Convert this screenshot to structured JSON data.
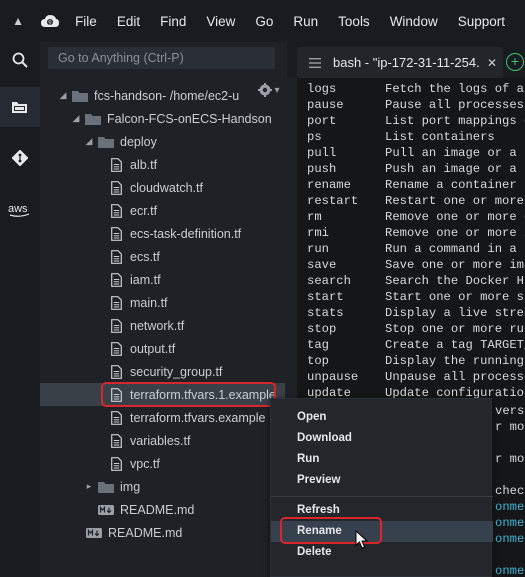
{
  "menubar": {
    "items": [
      "File",
      "Edit",
      "Find",
      "View",
      "Go",
      "Run",
      "Tools",
      "Window",
      "Support"
    ]
  },
  "search": {
    "placeholder": "Go to Anything (Ctrl-P)"
  },
  "tree": {
    "root_name": "fcs-handson",
    "root_path": " - /home/ec2-u",
    "project": "Falcon-FCS-onECS-Handson",
    "deploy_folder": "deploy",
    "deploy_files": [
      "alb.tf",
      "cloudwatch.tf",
      "ecr.tf",
      "ecs-task-definition.tf",
      "ecs.tf",
      "iam.tf",
      "main.tf",
      "network.tf",
      "output.tf",
      "security_group.tf",
      "terraform.tfvars.1.example",
      "terraform.tfvars.example",
      "variables.tf",
      "vpc.tf"
    ],
    "img_folder": "img",
    "readme_inner": "README.md",
    "readme_root": "README.md"
  },
  "terminal": {
    "tab_title": "bash - \"ip-172-31-11-254.",
    "lines": [
      {
        "cmd": "logs",
        "desc": "Fetch the logs of a co"
      },
      {
        "cmd": "pause",
        "desc": "Pause all processes wi"
      },
      {
        "cmd": "port",
        "desc": "List port mappings or"
      },
      {
        "cmd": "ps",
        "desc": "List containers"
      },
      {
        "cmd": "pull",
        "desc": "Pull an image or a rep"
      },
      {
        "cmd": "push",
        "desc": "Push an image or a rep"
      },
      {
        "cmd": "rename",
        "desc": "Rename a container"
      },
      {
        "cmd": "restart",
        "desc": "Restart one or more co"
      },
      {
        "cmd": "rm",
        "desc": "Remove one or more cont"
      },
      {
        "cmd": "rmi",
        "desc": "Remove one or more imag"
      },
      {
        "cmd": "run",
        "desc": "Run a command in a new"
      },
      {
        "cmd": "save",
        "desc": "Save one or more images"
      },
      {
        "cmd": "search",
        "desc": "Search the Docker Hub f"
      },
      {
        "cmd": "start",
        "desc": "Start one or more stopp"
      },
      {
        "cmd": "stats",
        "desc": "Display a live stream o"
      },
      {
        "cmd": "stop",
        "desc": "Stop one or more runnin"
      },
      {
        "cmd": "tag",
        "desc": "Create a tag TARGET_IMA"
      },
      {
        "cmd": "top",
        "desc": "Display the running pro"
      },
      {
        "cmd": "unpause",
        "desc": "Unpause all processes w"
      },
      {
        "cmd": "update",
        "desc": "Update configuration of"
      }
    ],
    "overflow_lines": [
      "versio",
      "r mor",
      "r mor",
      "check",
      "onment",
      "onment",
      "onment",
      "onment"
    ]
  },
  "context_menu": {
    "group1": [
      "Open",
      "Download",
      "Run",
      "Preview"
    ],
    "group2": [
      "Refresh",
      "Rename",
      "Delete"
    ]
  },
  "colors": {
    "accent_highlight": "#d9262a",
    "folder_color": "#6b7178",
    "add_terminal_green": "#3ec46d"
  }
}
